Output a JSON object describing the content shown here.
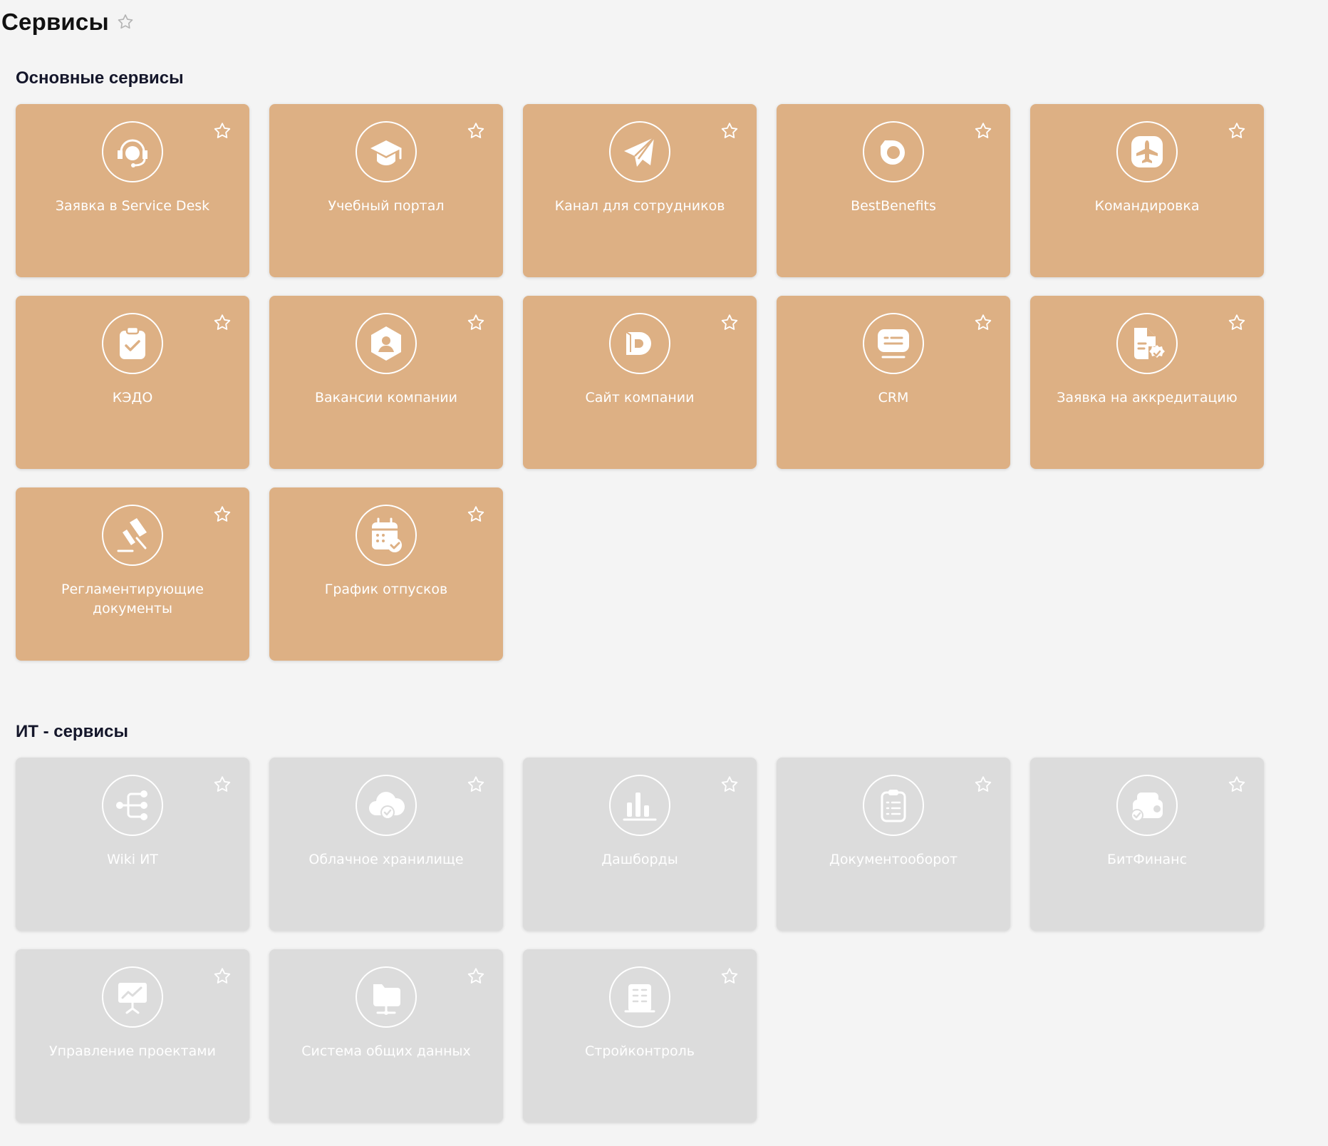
{
  "page": {
    "title": "Сервисы"
  },
  "colors": {
    "main_card": "#ddb084",
    "it_card": "#dcdcdc",
    "background": "#f4f4f4",
    "heading": "#14162a"
  },
  "sections": [
    {
      "title": "Основные сервисы",
      "items": [
        {
          "label": "Заявка в Service Desk",
          "icon": "headset-icon"
        },
        {
          "label": "Учебный портал",
          "icon": "graduation-cap-icon"
        },
        {
          "label": "Канал для сотрудников",
          "icon": "paper-plane-icon"
        },
        {
          "label": "BestBenefits",
          "icon": "ring-logo-icon"
        },
        {
          "label": "Командировка",
          "icon": "airplane-icon"
        },
        {
          "label": "КЭДО",
          "icon": "clipboard-check-icon"
        },
        {
          "label": "Вакансии компании",
          "icon": "user-hexagon-icon"
        },
        {
          "label": "Сайт компании",
          "icon": "company-logo-icon"
        },
        {
          "label": "CRM",
          "icon": "chat-message-icon"
        },
        {
          "label": "Заявка на аккредитацию",
          "icon": "document-badge-icon"
        },
        {
          "label": "Регламентирующие документы",
          "icon": "gavel-icon"
        },
        {
          "label": "График отпусков",
          "icon": "calendar-check-icon"
        }
      ]
    },
    {
      "title": "ИТ - сервисы",
      "items": [
        {
          "label": "Wiki ИТ",
          "icon": "tree-structure-icon"
        },
        {
          "label": "Облачное хранилище",
          "icon": "cloud-check-icon"
        },
        {
          "label": "Дашборды",
          "icon": "bar-chart-icon"
        },
        {
          "label": "Документооборот",
          "icon": "clipboard-list-icon"
        },
        {
          "label": "БитФинанс",
          "icon": "wallet-check-icon"
        },
        {
          "label": "Управление проектами",
          "icon": "presentation-board-icon"
        },
        {
          "label": "Система общих данных",
          "icon": "folder-network-icon"
        },
        {
          "label": "Стройконтроль",
          "icon": "building-icon"
        }
      ]
    }
  ]
}
